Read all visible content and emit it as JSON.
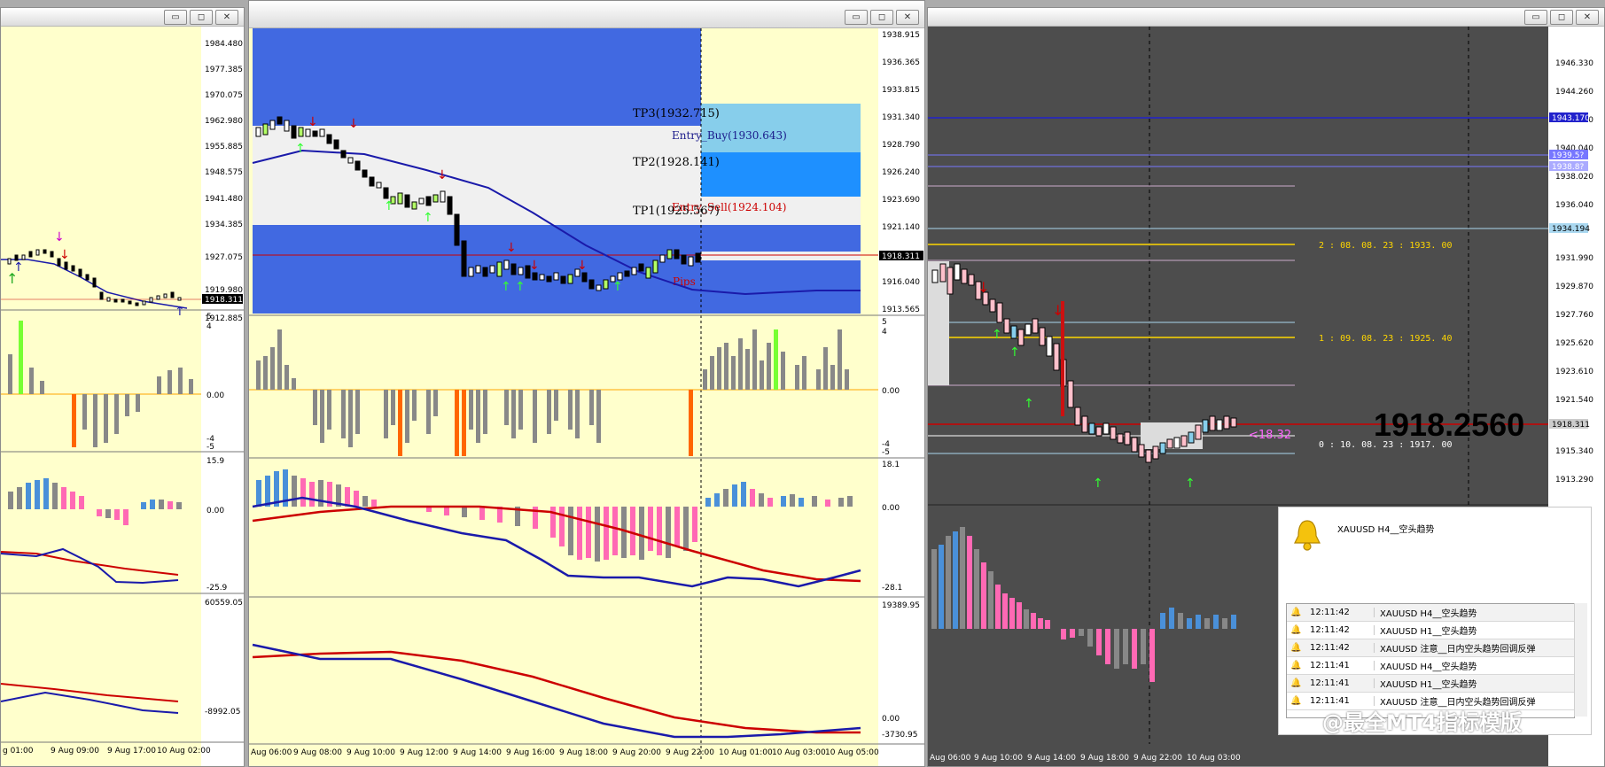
{
  "window_controls": {
    "minimize": "▭",
    "restore": "◻",
    "close": "✕"
  },
  "left_chart": {
    "price_axis": [
      "1984.480",
      "1977.385",
      "1970.075",
      "1962.980",
      "1955.885",
      "1948.575",
      "1941.480",
      "1934.385",
      "1927.075",
      "1919.980",
      "1912.885"
    ],
    "current_price": "1918.311",
    "ind1_axis": [
      "5",
      "4",
      "0.00",
      "-4",
      "-5"
    ],
    "ind2_axis": [
      "15.9",
      "0.00",
      "-25.9"
    ],
    "ind3_axis": [
      "60559.05",
      "-8992.05"
    ],
    "time_axis": [
      "g 01:00",
      "9 Aug 09:00",
      "9 Aug 17:00",
      "10 Aug 02:00"
    ]
  },
  "mid_chart": {
    "price_axis": [
      "1938.915",
      "1936.365",
      "1933.815",
      "1931.340",
      "1928.790",
      "1926.240",
      "1923.690",
      "1921.140",
      "1918.311",
      "1916.040",
      "1913.565"
    ],
    "current_price": "1918.311",
    "labels": {
      "tp3": "TP3(1932.715)",
      "entry_buy": "Entry_Buy(1930.643)",
      "tp2": "TP2(1928.141)",
      "entry_sell": "Entry_Sell(1924.104)",
      "tp1": "TP1(1925.567)",
      "pips": "Pips"
    },
    "ind1_axis": [
      "5",
      "4",
      "0.00",
      "-4",
      "-5"
    ],
    "ind2_axis": [
      "18.1",
      "0.00",
      "-28.1"
    ],
    "ind3_axis": [
      "19389.95",
      "0.00",
      "-3730.95"
    ],
    "time_axis": [
      "Aug 06:00",
      "9 Aug 08:00",
      "9 Aug 10:00",
      "9 Aug 12:00",
      "9 Aug 14:00",
      "9 Aug 16:00",
      "9 Aug 18:00",
      "9 Aug 20:00",
      "9 Aug 22:00",
      "10 Aug 01:00",
      "10 Aug 03:00",
      "10 Aug 05:00"
    ]
  },
  "right_chart": {
    "price_axis": [
      "1946.330",
      "1944.260",
      "1942.110",
      "1940.040",
      "1938.020",
      "1936.040",
      "1934.194",
      "1931.990",
      "1929.870",
      "1927.760",
      "1925.620",
      "1923.610",
      "1921.540",
      "1919.480",
      "1917.311",
      "1915.340",
      "1913.290"
    ],
    "tags": {
      "blue": "1943.170",
      "purple1": "1939.5?",
      "purple2": "1938.8?",
      "light": "1934.194",
      "current": "1918.311"
    },
    "levels": [
      "2 : 08. 08. 23 : 1933. 00",
      "1 : 09. 08. 23 : 1925. 40",
      "0 : 10. 08. 23 : 1917. 00"
    ],
    "pips_label": "<18.32",
    "big_price": "1918.2560",
    "time_axis": [
      "Aug 06:00",
      "9 Aug 10:00",
      "9 Aug 14:00",
      "9 Aug 18:00",
      "9 Aug 22:00",
      "10 Aug 03:00"
    ]
  },
  "alert": {
    "header": "XAUUSD H4__空头趋势",
    "rows": [
      {
        "time": "12:11:42",
        "msg": "XAUUSD H4__空头趋势"
      },
      {
        "time": "12:11:42",
        "msg": "XAUUSD H1__空头趋势"
      },
      {
        "time": "12:11:42",
        "msg": "XAUUSD 注意__日内空头趋势回调反弹"
      },
      {
        "time": "12:11:41",
        "msg": "XAUUSD H4__空头趋势"
      },
      {
        "time": "12:11:41",
        "msg": "XAUUSD H1__空头趋势"
      },
      {
        "time": "12:11:41",
        "msg": "XAUUSD 注意__日内空头趋势回调反弹"
      }
    ]
  },
  "watermark": "@最全MT4指标模版",
  "colors": {
    "chart_bg": "#ffffcc",
    "dark_bg": "#4d4d4d",
    "blue_zone": "#4169e1",
    "red_line": "#cc0000",
    "ma_blue": "#1a1aaa",
    "gold": "#ffd700"
  }
}
